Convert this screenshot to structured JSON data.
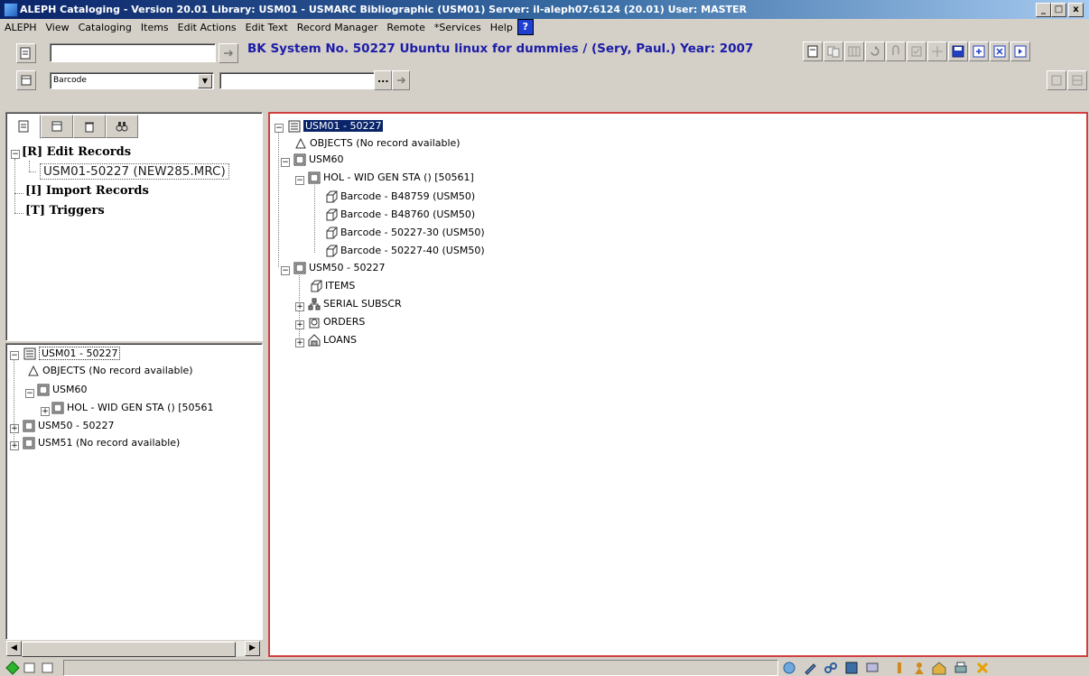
{
  "window": {
    "title": "ALEPH Cataloging - Version 20.01 Library: USM01 - USMARC Bibliographic (USM01) Server: il-aleph07:6124 (20.01) User: MASTER",
    "min_label": "_",
    "max_label": "□",
    "close_label": "x"
  },
  "menu": {
    "items": [
      "ALEPH",
      "View",
      "Cataloging",
      "Items",
      "Edit Actions",
      "Edit Text",
      "Record Manager",
      "Remote",
      "*Services",
      "Help"
    ],
    "help_icon_label": "?"
  },
  "toolbar": {
    "record_title": "BK System No. 50227 Ubuntu linux for dummies / (Sery, Paul.) Year: 2007",
    "search_value": "",
    "search_type": "Barcode",
    "search_text": "",
    "ellipsis_label": "..."
  },
  "left_top": {
    "nodes": [
      {
        "label": "[R] Edit Records"
      },
      {
        "label": "USM01-50227 (NEW285.MRC)"
      },
      {
        "label": "[I] Import Records"
      },
      {
        "label": "[T] Triggers"
      }
    ]
  },
  "left_bottom": {
    "nodes": [
      {
        "label": "USM01 - 50227"
      },
      {
        "label": "OBJECTS (No record available)"
      },
      {
        "label": "USM60"
      },
      {
        "label": "HOL - WID GEN STA () [50561"
      },
      {
        "label": "USM50 - 50227"
      },
      {
        "label": "USM51 (No record available)"
      }
    ]
  },
  "main_tree": {
    "nodes": [
      {
        "label": "USM01 - 50227"
      },
      {
        "label": "OBJECTS (No record available)"
      },
      {
        "label": "USM60"
      },
      {
        "label": "HOL - WID GEN STA () [50561]"
      },
      {
        "label": "Barcode - B48759 (USM50)"
      },
      {
        "label": "Barcode - B48760 (USM50)"
      },
      {
        "label": "Barcode - 50227-30 (USM50)"
      },
      {
        "label": "Barcode - 50227-40 (USM50)"
      },
      {
        "label": "USM50 - 50227"
      },
      {
        "label": "ITEMS"
      },
      {
        "label": "SERIAL SUBSCR"
      },
      {
        "label": "ORDERS"
      },
      {
        "label": "LOANS"
      }
    ]
  },
  "colors": {
    "title_bar": "#0a246a",
    "record_title": "#1c1ca8",
    "main_border": "#d04040",
    "selection": "#0a246a"
  }
}
